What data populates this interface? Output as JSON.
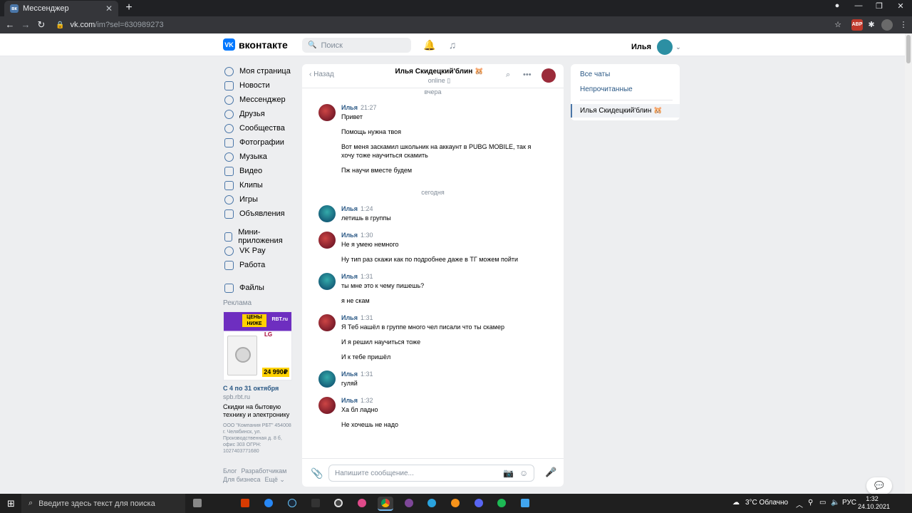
{
  "browser": {
    "tab_title": "Мессенджер",
    "url_host": "vk.com",
    "url_path": "/im?sel=630989273"
  },
  "header": {
    "logo_text": "вконтакте",
    "search_placeholder": "Поиск",
    "user_name": "Илья"
  },
  "nav": {
    "main": [
      "Моя страница",
      "Новости",
      "Мессенджер",
      "Друзья",
      "Сообщества",
      "Фотографии",
      "Музыка",
      "Видео",
      "Клипы",
      "Игры",
      "Объявления"
    ],
    "services": [
      "Мини-приложения",
      "VK Pay",
      "Работа"
    ],
    "files": "Файлы",
    "ad_label": "Реклама",
    "footer": [
      "Блог",
      "Разработчикам",
      "Для бизнеса",
      "Ещё ⌄"
    ]
  },
  "ad": {
    "badge": "ЦЕНЫ НИЖЕ",
    "brand": "RBT.ru",
    "maker": "LG",
    "price": "24 990₽",
    "title": "С 4 по 31 октября",
    "url": "spb.rbt.ru",
    "desc": "Скидки на бытовую технику и электронику",
    "legal": "ООО \"Компания РБТ\" 454008 г. Челябинск, ул. Производственная д. 8 б, офис 303 ОГРН: 1027403771680"
  },
  "chat": {
    "back": "Назад",
    "title": "Илья Скидецкий'блин 🐹",
    "status": "online ▯",
    "day_yesterday": "вчера",
    "day_today": "сегодня",
    "composer_placeholder": "Напишите сообщение...",
    "messages": [
      {
        "name": "Илья",
        "time": "21:27",
        "lines": [
          "Привет",
          "Помощь нужна твоя",
          "Вот меня заскамил школьник на аккаунт в PUBG MOBILE, так я хочу тоже научиться скамить",
          "Пж научи вместе будем"
        ]
      },
      {
        "name": "Илья",
        "time": "1:24",
        "lines": [
          "летишь в группы"
        ]
      },
      {
        "name": "Илья",
        "time": "1:30",
        "lines": [
          "Не я умею немного",
          "Ну тип раз скажи как по подробнее даже в ТГ можем пойти"
        ]
      },
      {
        "name": "Илья",
        "time": "1:31",
        "lines": [
          "ты мне это к чему пишешь?",
          "я не скам"
        ]
      },
      {
        "name": "Илья",
        "time": "1:31",
        "lines": [
          "Я Теб нашёл в группе много чел писали что ты скамер",
          "И я решил научиться тоже",
          "И к тебе пришёл"
        ]
      },
      {
        "name": "Илья",
        "time": "1:31",
        "lines": [
          "гуляй"
        ]
      },
      {
        "name": "Илья",
        "time": "1:32",
        "lines": [
          "Ха бл ладно",
          "Не хочешь не надо"
        ]
      }
    ]
  },
  "right_panel": {
    "all_chats": "Все чаты",
    "unread": "Непрочитанные",
    "active_chat": "Илья Скидецкий'блин 🐹"
  },
  "taskbar": {
    "search_placeholder": "Введите здесь текст для поиска",
    "weather": "3°C  Облачно",
    "lang": "РУС",
    "time": "1:32",
    "date": "24.10.2021"
  }
}
